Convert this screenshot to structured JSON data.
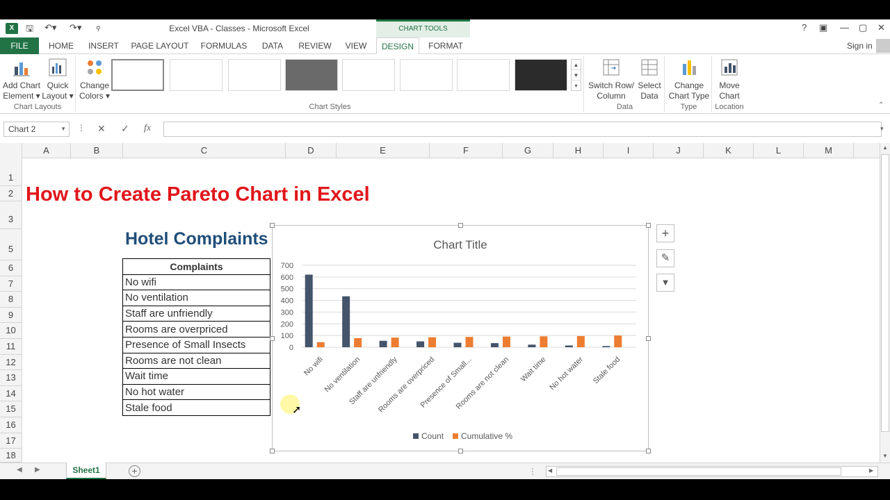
{
  "window": {
    "title": "Excel VBA - Classes - Microsoft Excel",
    "app_icon": "X",
    "help": "?",
    "controls": [
      "?",
      "▣",
      "—",
      "▢",
      "✕"
    ],
    "sign_in": "Sign in",
    "chart_tools_label": "CHART TOOLS"
  },
  "ribbon_tabs": [
    "FILE",
    "HOME",
    "INSERT",
    "PAGE LAYOUT",
    "FORMULAS",
    "DATA",
    "REVIEW",
    "VIEW",
    "DESIGN",
    "FORMAT"
  ],
  "ribbon": {
    "chart_layouts": {
      "label": "Chart Layouts",
      "add_chart_element": [
        "Add Chart",
        "Element ▾"
      ],
      "quick_layout": [
        "Quick",
        "Layout ▾"
      ]
    },
    "chart_styles": {
      "label": "Chart Styles",
      "change_colors": [
        "Change",
        "Colors ▾"
      ]
    },
    "data": {
      "label": "Data",
      "switch_row_column": [
        "Switch Row/",
        "Column"
      ],
      "select_data": [
        "Select",
        "Data"
      ]
    },
    "type": {
      "label": "Type",
      "change_chart_type": [
        "Change",
        "Chart Type"
      ]
    },
    "location": {
      "label": "Location",
      "move_chart": [
        "Move",
        "Chart"
      ]
    }
  },
  "formula_bar": {
    "name_box": "Chart 2",
    "cancel": "✕",
    "enter": "✓",
    "fx": "fx",
    "value": ""
  },
  "columns": [
    "A",
    "B",
    "C",
    "D",
    "E",
    "F",
    "G",
    "H",
    "I",
    "J",
    "K",
    "L",
    "M"
  ],
  "rows": [
    "1",
    "2",
    "3",
    "5",
    "6",
    "7",
    "8",
    "9",
    "10",
    "11",
    "12",
    "13",
    "14",
    "15",
    "16",
    "17",
    "18"
  ],
  "sheet": {
    "title": "How to Create Pareto Chart in Excel",
    "table_title": "Hotel Complaints",
    "table_header": "Complaints",
    "complaints": [
      "No wifi",
      "No ventilation",
      "Staff are unfriendly",
      "Rooms are overpriced",
      "Presence of Small Insects",
      "Rooms are not clean",
      "Wait time",
      "No hot water",
      "Stale food"
    ]
  },
  "chart_data": {
    "type": "bar",
    "title": "Chart Title",
    "categories": [
      "No wifi",
      "No ventilation",
      "Staff are unfriendly",
      "Rooms are overpriced",
      "Presence of Small...",
      "Rooms are not clean",
      "Wait time",
      "No hot water",
      "Stale food"
    ],
    "series": [
      {
        "name": "Count",
        "values": [
          620,
          435,
          55,
          50,
          38,
          35,
          22,
          15,
          10
        ],
        "color": "#44546a"
      },
      {
        "name": "Cumulative %",
        "values": [
          43,
          78,
          82,
          85,
          88,
          91,
          93,
          95,
          100
        ],
        "color": "#ed7d31"
      }
    ],
    "ylim": [
      0,
      700
    ],
    "yticks": [
      0,
      100,
      200,
      300,
      400,
      500,
      600,
      700
    ],
    "grid": true,
    "legend": "bottom"
  },
  "side_buttons": {
    "elements": "+",
    "styles": "✎",
    "filters": "▼"
  },
  "sheet_tabs": {
    "active": "Sheet1",
    "add": "+"
  }
}
